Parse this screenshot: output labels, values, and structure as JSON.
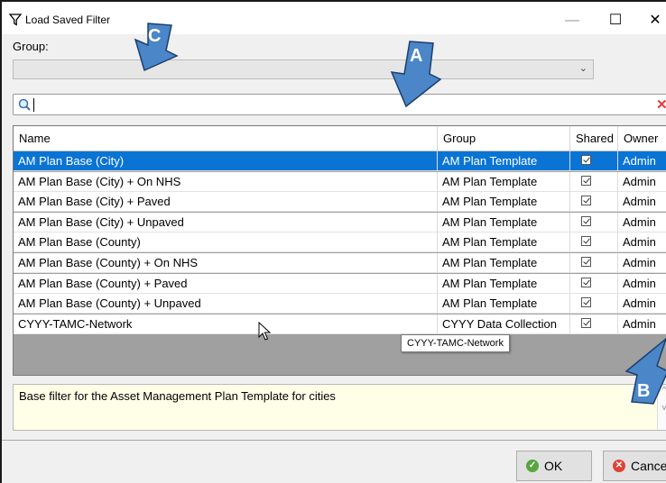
{
  "window": {
    "title": "Load Saved Filter",
    "title_icon": "filter-icon",
    "min_glyph": "—",
    "max_glyph": "☐",
    "close_glyph": "✕"
  },
  "group": {
    "label": "Group:",
    "value": ""
  },
  "search": {
    "value": "",
    "clear_glyph": "✕"
  },
  "table": {
    "columns": [
      "Name",
      "Group",
      "Shared",
      "Owner"
    ],
    "rows": [
      {
        "name": "AM Plan Base (City)",
        "group": "AM Plan Template",
        "shared": true,
        "owner": "Admin",
        "selected": true
      },
      {
        "name": "AM Plan Base (City) + On NHS",
        "group": "AM Plan Template",
        "shared": true,
        "owner": "Admin"
      },
      {
        "name": "AM Plan Base (City) + Paved",
        "group": "AM Plan Template",
        "shared": true,
        "owner": "Admin"
      },
      {
        "name": "AM Plan Base (City) + Unpaved",
        "group": "AM Plan Template",
        "shared": true,
        "owner": "Admin"
      },
      {
        "name": "AM Plan Base (County)",
        "group": "AM Plan Template",
        "shared": true,
        "owner": "Admin"
      },
      {
        "name": "AM Plan Base (County) + On NHS",
        "group": "AM Plan Template",
        "shared": true,
        "owner": "Admin"
      },
      {
        "name": "AM Plan Base (County) + Paved",
        "group": "AM Plan Template",
        "shared": true,
        "owner": "Admin"
      },
      {
        "name": "AM Plan Base (County) + Unpaved",
        "group": "AM Plan Template",
        "shared": true,
        "owner": "Admin"
      },
      {
        "name": "CYYY-TAMC-Network",
        "group": "CYYY Data Collection",
        "shared": true,
        "owner": "Admin"
      }
    ]
  },
  "tooltip": "CYYY-TAMC-Network",
  "description": "Base filter for the Asset Management Plan Template for cities",
  "buttons": {
    "ok": "OK",
    "cancel": "Cancel"
  },
  "callouts": {
    "a": "A",
    "b": "B",
    "c": "C"
  },
  "colors": {
    "selection": "#0a74d4",
    "callout_arrow": "#4a86c8",
    "description_bg": "#ffffe8"
  }
}
